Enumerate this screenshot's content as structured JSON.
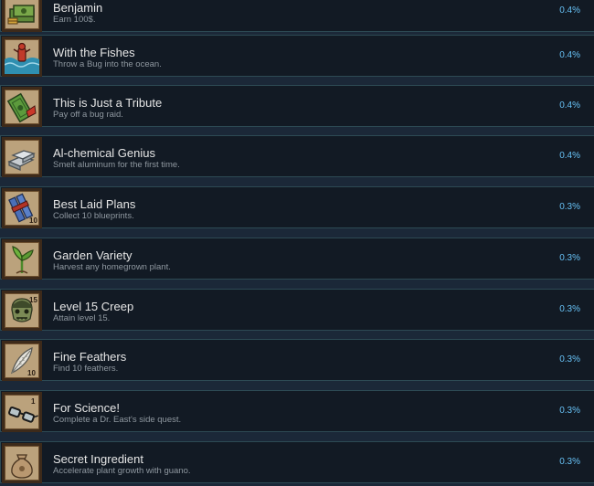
{
  "achievements": [
    {
      "title": "Benjamin",
      "description": "Earn 100$.",
      "percent": "0.4%",
      "icon": "money-stack-icon"
    },
    {
      "title": "With the Fishes",
      "description": "Throw a Bug into the ocean.",
      "percent": "0.4%",
      "icon": "bug-in-ocean-icon"
    },
    {
      "title": "This is Just a Tribute",
      "description": "Pay off a bug raid.",
      "percent": "0.4%",
      "icon": "tribute-bill-icon"
    },
    {
      "title": "Al-chemical Genius",
      "description": "Smelt aluminum for the first time.",
      "percent": "0.4%",
      "icon": "aluminum-ingots-icon"
    },
    {
      "title": "Best Laid Plans",
      "description": "Collect 10 blueprints.",
      "percent": "0.3%",
      "icon": "blueprints-icon",
      "badge": "10"
    },
    {
      "title": "Garden Variety",
      "description": "Harvest any homegrown plant.",
      "percent": "0.3%",
      "icon": "sprout-icon"
    },
    {
      "title": "Level 15 Creep",
      "description": "Attain level 15.",
      "percent": "0.3%",
      "icon": "creep-face-icon",
      "badge": "15"
    },
    {
      "title": "Fine Feathers",
      "description": "Find 10 feathers.",
      "percent": "0.3%",
      "icon": "feather-icon",
      "badge": "10"
    },
    {
      "title": "For Science!",
      "description": "Complete a Dr. East's side quest.",
      "percent": "0.3%",
      "icon": "glasses-icon",
      "badge": "1"
    },
    {
      "title": "Secret Ingredient",
      "description": "Accelerate plant growth with guano.",
      "percent": "0.3%",
      "icon": "guano-sack-icon"
    }
  ],
  "colors": {
    "row_background": "#121a24",
    "row_border": "#2d4a54",
    "title": "#e6e6e6",
    "description": "#8f98a0",
    "percent": "#67c1f5"
  }
}
